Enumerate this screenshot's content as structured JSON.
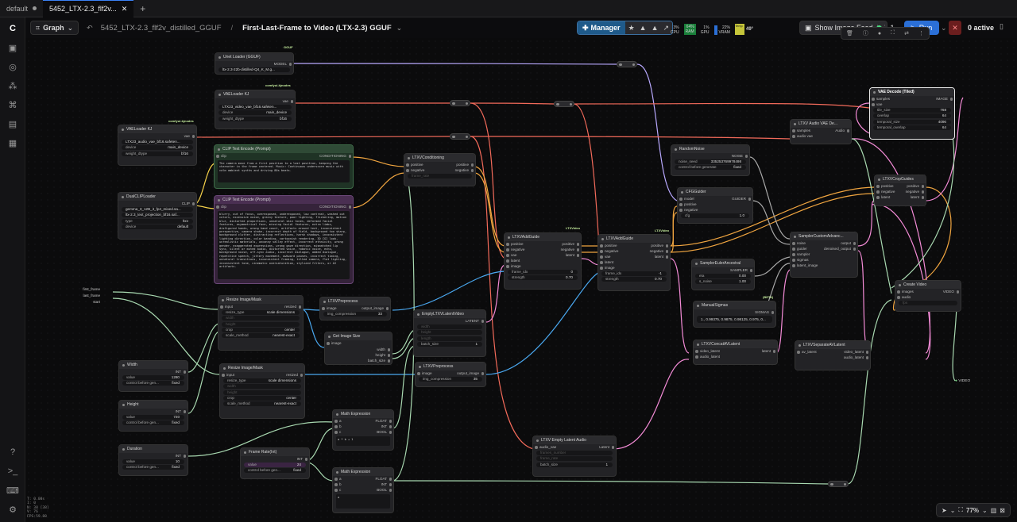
{
  "tabs": [
    {
      "label": "default"
    },
    {
      "label": "5452_LTX-2.3_flf2v..."
    }
  ],
  "topbar": {
    "graph_label": "Graph",
    "workflow_name": "5452_LTX-2.3_flf2v_distilled_GGUF",
    "separator": "/",
    "subgraph_name": "First-Last-Frame to Video (LTX-2.3) GGUF",
    "manager": "Manager",
    "stats": [
      {
        "v": "3%",
        "l": "CPU"
      },
      {
        "v": "64%",
        "l": "RAM"
      },
      {
        "v": "1%",
        "l": "GPU"
      },
      {
        "v": "22%",
        "l": "VRAM"
      },
      {
        "v": "49°",
        "l": "Temp"
      }
    ],
    "show_feed": "Show Image Feed",
    "queue_count": "1",
    "run": "Run",
    "active": "0 active"
  },
  "nodes": {
    "unet": {
      "title": "Unet Loader (GGUF)",
      "badge": "GGUF",
      "out": "MODEL",
      "w1": "ltx-2.3-22b-distilled-Q4_K_M.g..."
    },
    "vae1": {
      "title": "VAELoader KJ",
      "badge": "comfyui-kjnodes",
      "out": "vae",
      "w1": "LTX23_video_vae_bf16.safeten...",
      "w2": "device",
      "w2v": "main_device",
      "w3": "weight_dtype",
      "w3v": "bf16"
    },
    "vae2": {
      "title": "VAELoader KJ",
      "badge": "comfyui-kjnodes",
      "out": "vae",
      "w1": "LTX23_audio_vae_bf16.safeten...",
      "w2": "device",
      "w2v": "main_device",
      "w3": "weight_dtype",
      "w3v": "bf16"
    },
    "dual": {
      "title": "DualCLIPLoader",
      "out": "CLIP",
      "w1": "gemma_3_12B_it_fp4_mixed.sa...",
      "w2": "ltx-2.3_text_projection_bf16.saf...",
      "w3": "type",
      "w3v": "ltxv",
      "w4": "device",
      "w4v": "default"
    },
    "pos": {
      "title": "CLIP Text Encode (Prompt)",
      "in": "clip",
      "out": "CONDITIONING",
      "text": "The camera move from a first position to a last position, keeping the character in the frame centered. Music: Continuous underscore music with calm ambient synths and driving 80s beats."
    },
    "neg": {
      "title": "CLIP Text Encode (Prompt)",
      "in": "clip",
      "out": "CONDITIONING",
      "text": "blurry, out of focus, overexposed, underexposed, low contrast, washed out colors, excessive noise, grainy texture, poor lighting, flickering, motion blur, distorted proportions, unnatural skin tones, deformed facial features, asymmetrical face, missing facial features, extra limbs, disfigured hands, wrong hand count, artifacts around text, inconsistent perspective, camera shake, incorrect depth of field, background too sharp, background clutter, distracting reflections, harsh shadows, inconsistent lighting direction, color banding, cartoonish rendering, 3D CGI look, unrealistic materials, uncanny valley effect, incorrect ethnicity, wrong gender, exaggerated expressions, wrong gaze direction, mismatched lip sync, silent or muted audio, distorted voice, robotic voice, echo, background noise, off-sync audio, incorrect dialogue, added dialogue, repetitive speech, jittery movement, awkward pauses, incorrect timing, unnatural transitions, inconsistent framing, tilted camera, flat lighting, inconsistent tone, cinematic oversaturation, stylized filters, or AI artifacts."
    },
    "cond": {
      "title": "LTXVConditioning",
      "in1": "positive",
      "in2": "negative",
      "out1": "positive",
      "out2": "negative",
      "w1": "frame_rate"
    },
    "frames": {
      "i1": "first_frame",
      "i2": "last_frame",
      "i3": "start"
    },
    "resize1": {
      "title": "Resize Image/Mask",
      "in": "input",
      "out": "resized",
      "w1": "resize_type",
      "w1v": "scale dimensions",
      "w2": "width",
      "w3": "height",
      "w4": "crop",
      "w4v": "center",
      "w5": "scale_method",
      "w5v": "nearest-exact"
    },
    "resize2": {
      "title": "Resize Image/Mask",
      "in": "input",
      "out": "resized",
      "w1": "resize_type",
      "w1v": "scale dimensions",
      "w2": "width",
      "w3": "height",
      "w4": "crop",
      "w4v": "center",
      "w5": "scale_method",
      "w5v": "nearest-exact"
    },
    "pre1": {
      "title": "LTXVPreprocess",
      "in": "image",
      "out": "output_image",
      "w1": "img_compression",
      "w1v": "33"
    },
    "pre2": {
      "title": "LTXVPreprocess",
      "in": "image",
      "out": "output_image",
      "w1": "img_compression",
      "w1v": "35"
    },
    "getsize": {
      "title": "Get Image Size",
      "in": "image",
      "o1": "width",
      "o2": "height",
      "o3": "batch_size"
    },
    "empty": {
      "title": "EmptyLTXVLatentVideo",
      "out": "LATENT",
      "w1": "width",
      "w2": "height",
      "w3": "length",
      "w4": "batch_size",
      "w4v": "1"
    },
    "width": {
      "title": "Width",
      "out": "INT",
      "w1": "value",
      "w1v": "1280",
      "w2": "control before gen...",
      "w2v": "fixed"
    },
    "height": {
      "title": "Height",
      "out": "INT",
      "w1": "value",
      "w1v": "720",
      "w2": "control before gen...",
      "w2v": "fixed"
    },
    "duration": {
      "title": "Duration",
      "out": "INT",
      "w1": "value",
      "w1v": "10",
      "w2": "control before gen...",
      "w2v": "fixed"
    },
    "framerate": {
      "title": "Frame Rate(Int)",
      "out": "INT",
      "w1": "value",
      "w1v": "24",
      "w2": "control before gen...",
      "w2v": "fixed"
    },
    "math1": {
      "title": "Math Expression",
      "in1": "a",
      "in2": "b",
      "in3": "c",
      "o1": "FLOAT",
      "o2": "INT",
      "o3": "BOOL",
      "expr": "a * b + 1"
    },
    "math2": {
      "title": "Math Expression",
      "in1": "a",
      "in2": "b",
      "in3": "c",
      "o1": "FLOAT",
      "o2": "INT",
      "o3": "BOOL",
      "expr": "a"
    },
    "guide1": {
      "title": "LTXVAddGuide",
      "badge": "LTXVideo",
      "ins": [
        "positive",
        "negative",
        "vae",
        "latent",
        "image"
      ],
      "o1": "positive",
      "o2": "negative",
      "o3": "latent",
      "w1": "frame_idx",
      "w1v": "0",
      "w2": "strength",
      "w2v": "0.70"
    },
    "guide2": {
      "title": "LTXVAddGuide",
      "badge": "LTXVideo",
      "ins": [
        "positive",
        "negative",
        "vae",
        "latent",
        "image"
      ],
      "o1": "positive",
      "o2": "negative",
      "o3": "latent",
      "w1": "frame_idx",
      "w1v": "-1",
      "w2": "strength",
      "w2v": "0.70"
    },
    "noise": {
      "title": "RandomNoise",
      "out": "NOISE",
      "w1": "noise_seed",
      "w1v": "335253769978498",
      "w2": "control before generate",
      "w2v": "fixed"
    },
    "cfg": {
      "title": "CFGGuider",
      "ins": [
        "model",
        "positive",
        "negative"
      ],
      "out": "GUIDER",
      "w1": "cfg",
      "w1v": "1.0"
    },
    "sampsel": {
      "title": "SamplerEulerAncestral",
      "out": "SAMPLER",
      "w1": "eta",
      "w1v": "0.00",
      "w2": "s_noise",
      "w2v": "1.00"
    },
    "sigmas": {
      "title": "ManualSigmas",
      "badge": "(BETA)",
      "out": "SIGMAS",
      "w1": "1., 0.99375, 0.9875, 0.98125, 0.975, 0..."
    },
    "concat": {
      "title": "LTXVConcatAVLatent",
      "i1": "video_latent",
      "i2": "audio_latent",
      "out": "latent"
    },
    "audiovae": {
      "title": "LTXV Audio VAE De...",
      "i1": "samples",
      "i2": "audio vae",
      "out": "Audio"
    },
    "sampler": {
      "title": "SamplerCustomAdvanc...",
      "ins": [
        "noise",
        "guider",
        "sampler",
        "sigmas",
        "latent_image"
      ],
      "o1": "output",
      "o2": "denoised_output"
    },
    "separate": {
      "title": "LTXVSeparateAVLatent",
      "in": "av_latent",
      "o1": "video_latent",
      "o2": "audio_latent"
    },
    "crop": {
      "title": "LTXVCropGuides",
      "ins": [
        "positive",
        "negative",
        "latent"
      ],
      "o1": "positive",
      "o2": "negative",
      "o3": "latent"
    },
    "vaedecode": {
      "title": "VAE Decode (Tiled)",
      "i1": "samples",
      "i2": "vae",
      "out": "IMAGE",
      "w1": "tile_size",
      "w1v": "768",
      "w2": "overlap",
      "w2v": "64",
      "w3": "temporal_size",
      "w3v": "4096",
      "w4": "temporal_overlap",
      "w4v": "64"
    },
    "create": {
      "title": "Create Video",
      "i1": "images",
      "i2": "audio",
      "i3": "fps",
      "out": "VIDEO"
    },
    "emptyaudio": {
      "title": "LTXV Empty Latent Audio",
      "in": "audio_vae",
      "out": "Latent",
      "w1": "frames_number",
      "w2": "frame_rate",
      "w3": "batch_size",
      "w3v": "1"
    },
    "video_out": {
      "label": "VIDEO"
    }
  },
  "bottom": {
    "zoom": "77%"
  },
  "status": [
    "T: 0.00s",
    "I: 0",
    "N: 38 [38]",
    "V: 76",
    "FPS:59.88"
  ]
}
